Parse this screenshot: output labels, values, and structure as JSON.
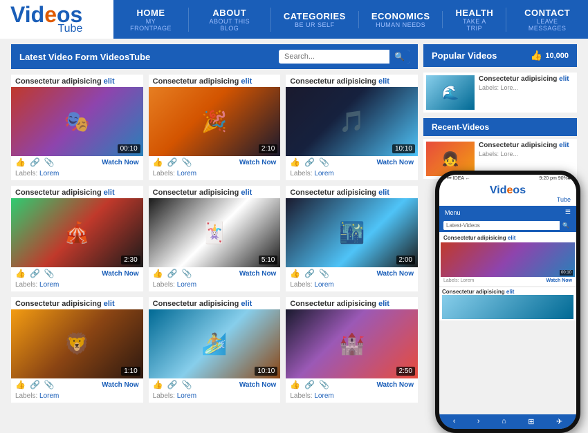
{
  "header": {
    "logo_main": "Videos",
    "logo_dot": "o",
    "logo_sub": "Tube",
    "nav": [
      {
        "main": "HOME",
        "sub": "MY FRONTPAGE"
      },
      {
        "main": "ABOUT",
        "sub": "ABOUT THIS BLOG"
      },
      {
        "main": "CATEGORIES",
        "sub": "BE UR SELF"
      },
      {
        "main": "ECONOMICS",
        "sub": "HUMAN NEEDS"
      },
      {
        "main": "HEALTH",
        "sub": "TAKE A TRIP"
      },
      {
        "main": "CONTACT",
        "sub": "LEAVE MESSAGES"
      }
    ]
  },
  "latest_section": {
    "title": "Latest Video Form VideosTube",
    "search_placeholder": "Search..."
  },
  "videos": [
    {
      "title": "Consectetur adipisicing",
      "title_highlight": "elit",
      "duration": "00:10",
      "labels": "Lorem"
    },
    {
      "title": "Consectetur adipisicing",
      "title_highlight": "elit",
      "duration": "2:10",
      "labels": "Lorem"
    },
    {
      "title": "Consectetur adipisicing",
      "title_highlight": "elit",
      "duration": "10:10",
      "labels": "Lorem"
    },
    {
      "title": "Consectetur adipisicing",
      "title_highlight": "elit",
      "duration": "2:30",
      "labels": "Lorem"
    },
    {
      "title": "Consectetur adipisicing",
      "title_highlight": "elit",
      "duration": "5:10",
      "labels": "Lorem"
    },
    {
      "title": "Consectetur adipisicing",
      "title_highlight": "elit",
      "duration": "2:00",
      "labels": "Lorem"
    },
    {
      "title": "Consectetur adipisicing",
      "title_highlight": "elit",
      "duration": "1:10",
      "labels": "Lorem"
    },
    {
      "title": "Consectetur adipisicing",
      "title_highlight": "elit",
      "duration": "10:10",
      "labels": "Lorem"
    },
    {
      "title": "Consectetur adipisicing",
      "title_highlight": "elit",
      "duration": "2:50",
      "labels": "Lorem"
    }
  ],
  "sidebar": {
    "popular_title": "Popular Videos",
    "like_count": "10,000",
    "recent_title": "Recent-Videos",
    "popular_videos": [
      {
        "title": "Consectetur adipisicing",
        "title_highlight": "elit",
        "labels": "Lore..."
      },
      {
        "title": "Consectetur adipisicing",
        "title_highlight": "elit",
        "labels": "Lore..."
      }
    ]
  },
  "phone": {
    "status_left": "•••• IDEA ←",
    "status_right": "9:20 pm    90% ■",
    "logo": "Videos",
    "logo_sub": "Tube",
    "menu": "Menu",
    "search_label": "Latest-Videos",
    "video_title": "Consectetur adipisicing",
    "video_title_highlight": "elit",
    "duration": "00:10",
    "watch_now": "Watch Now",
    "labels": "Labels: Lorem",
    "popular_title": "Consectetur adipisicing",
    "popular_title_highlight": "elit"
  },
  "watch_now_label": "Watch Now",
  "labels_prefix": "Labels: "
}
